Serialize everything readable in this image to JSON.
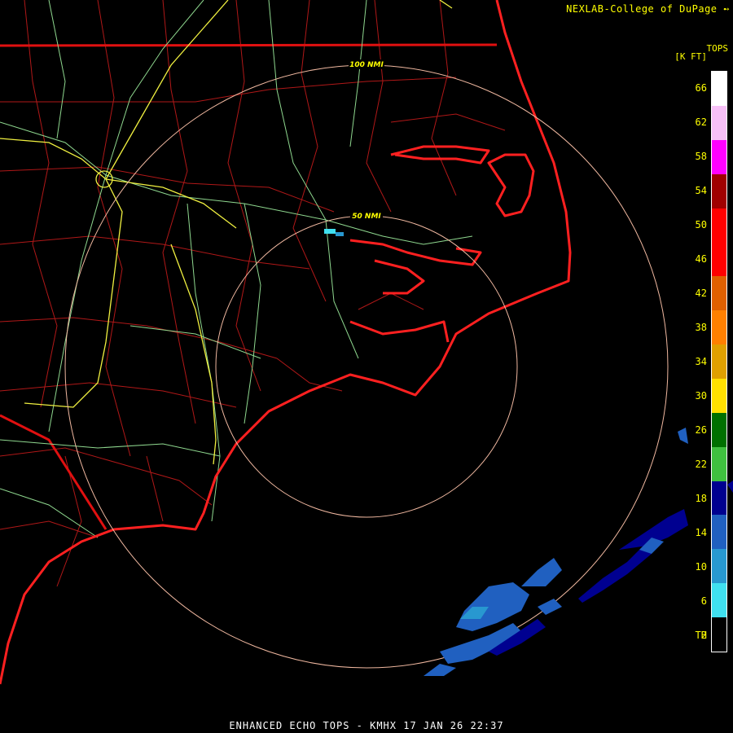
{
  "credit": "NEXLAB-College of DuPage",
  "credit_icon": "radar-logo-icon",
  "legend": {
    "title": "TOPS",
    "units": "[K FT]",
    "labels": [
      "66",
      "62",
      "58",
      "54",
      "50",
      "46",
      "42",
      "38",
      "34",
      "30",
      "26",
      "22",
      "18",
      "14",
      "10",
      "6",
      "2",
      "TH"
    ],
    "colors": [
      "#ffffff",
      "#f7c0f7",
      "#ff00ff",
      "#a00000",
      "#ff0000",
      "#ff0000",
      "#e06000",
      "#ff8000",
      "#e0a000",
      "#ffe000",
      "#007000",
      "#40c040",
      "#000090",
      "#2060c0",
      "#2898d0",
      "#40e0f0",
      "#000000"
    ]
  },
  "rings": {
    "inner_label": "50 NMI",
    "outer_label": "100 NMI"
  },
  "caption": "ENHANCED ECHO TOPS - KMHX 17 JAN 26 22:37",
  "colors": {
    "background": "#000000",
    "coastline": "#ff2020",
    "county_lines": "#c02020",
    "highways": "#90e090",
    "interstates": "#ffff40",
    "range_rings": "#f0b8a0"
  }
}
